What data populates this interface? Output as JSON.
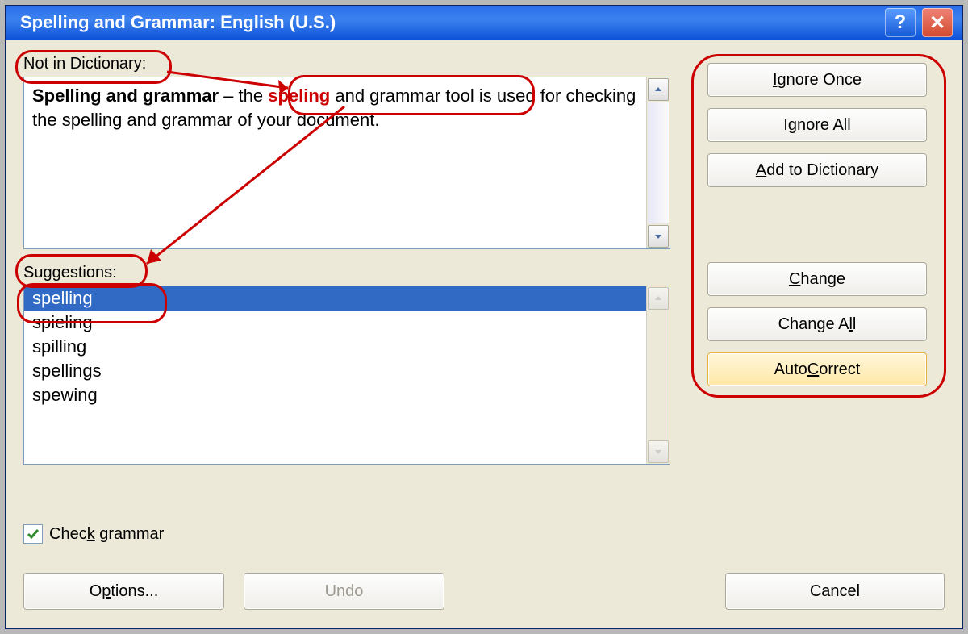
{
  "title": "Spelling and Grammar: English (U.S.)",
  "labels": {
    "not_in_dict": "Not in Dictionary:",
    "suggestions": "Suggestions:"
  },
  "context": {
    "bold_lead": "Spelling and grammar",
    "pre_err": " – the ",
    "error_word": "speling",
    "post_err": " and grammar tool is used for checking the spelling and grammar of your document."
  },
  "suggestions": [
    "spelling",
    "spieling",
    "spilling",
    "spellings",
    "spewing"
  ],
  "selected_suggestion_index": 0,
  "buttons": {
    "ignore_once": "Ignore Once",
    "ignore_all": "Ignore All",
    "add_dict": "Add to Dictionary",
    "change": "Change",
    "change_all": "Change All",
    "autocorrect": "AutoCorrect",
    "options": "Options...",
    "undo": "Undo",
    "cancel": "Cancel"
  },
  "check_grammar": {
    "label": "Check grammar",
    "checked": true
  },
  "caption": {
    "help": "?",
    "close": "✕"
  }
}
